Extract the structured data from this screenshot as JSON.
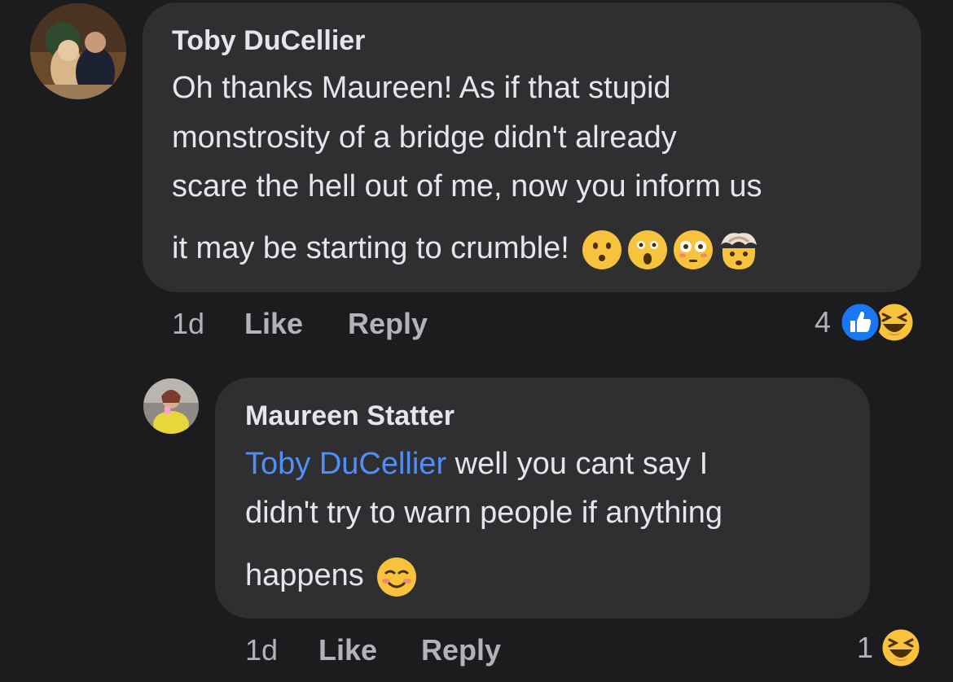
{
  "comments": [
    {
      "author": "Toby DuCellier",
      "lines": [
        "Oh thanks Maureen! As if that stupid",
        "monstrosity of a bridge didn't already",
        "scare the hell out of me, now you inform us",
        "it may be starting to crumble!"
      ],
      "emojis": [
        "hushed-face-emoji",
        "astonished-face-emoji",
        "flushed-face-emoji",
        "exploding-head-emoji"
      ],
      "time": "1d",
      "like_label": "Like",
      "reply_label": "Reply",
      "reaction_count": "4",
      "reactions": [
        "like-reaction-icon",
        "haha-reaction-icon"
      ]
    },
    {
      "author": "Maureen Statter",
      "mention": "Toby DuCellier",
      "line1_rest": " well you cant say I",
      "line2": "didn't try to warn people if anything",
      "line3": "happens",
      "emojis": [
        "smiling-face-emoji"
      ],
      "time": "1d",
      "like_label": "Like",
      "reply_label": "Reply",
      "reaction_count": "1",
      "reactions": [
        "haha-reaction-icon"
      ]
    }
  ],
  "colors": {
    "background": "#1c1c1e",
    "bubble": "#2f2f31",
    "mention": "#4f8ff7",
    "meta_text": "#b0b3b8",
    "like_blue": "#1877f2",
    "emoji_yellow": "#f7c23c"
  }
}
